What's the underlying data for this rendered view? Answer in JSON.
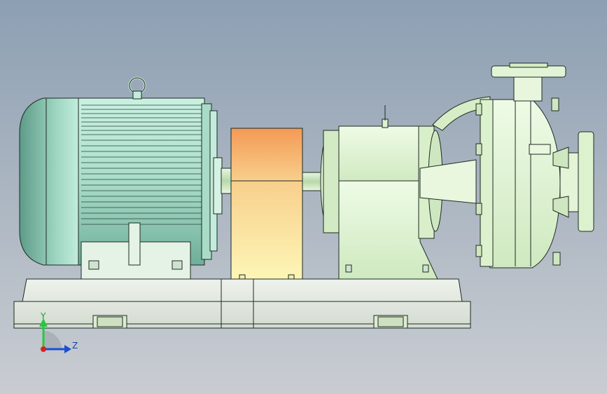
{
  "triad": {
    "y_label": "Y",
    "z_label": "Z",
    "y_color": "#27c93f",
    "z_color": "#1a4fd6",
    "x_color": "#e0201c"
  },
  "colors": {
    "motor": "#b9e8d8",
    "motor_shadow": "#7fbfae",
    "coupling_guard_top": "#f4a25a",
    "coupling_guard_bottom": "#fbf4b0",
    "pump_body": "#e4f5d8",
    "base": "#e9eee6",
    "outline": "#1e2a22"
  }
}
